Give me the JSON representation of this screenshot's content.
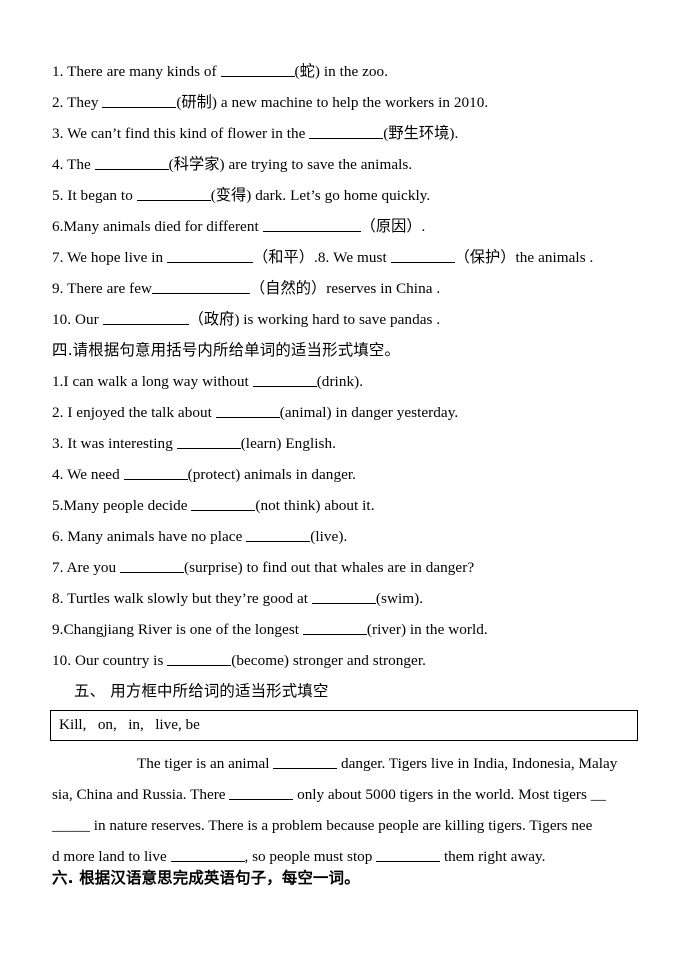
{
  "document": {
    "background_color": "#ffffff",
    "text_color": "#000000"
  },
  "section_three_questions": [
    {
      "id": "q1",
      "pre": "1. There are many kinds of ",
      "blank": "b-lg",
      "post": "(蛇) in the zoo."
    },
    {
      "id": "q2",
      "pre": "2. They ",
      "blank": "b-lg",
      "post": "(研制) a new machine to help the workers in 2010."
    },
    {
      "id": "q3",
      "pre": "3. We can’t find this kind of flower in the ",
      "blank": "b-lg",
      "post": "(野生环境)."
    },
    {
      "id": "q4",
      "pre": "4. The ",
      "blank": "b-lg",
      "post": "(科学家) are trying to save the animals."
    },
    {
      "id": "q5",
      "pre": "5. It began to ",
      "blank": "b-lg",
      "post": "(变得) dark. Let’s go home quickly."
    },
    {
      "id": "q6",
      "pre": " 6.Many animals died for different ",
      "blank": "b-xxl",
      "post": "（原因）."
    },
    {
      "id": "q7",
      "pre": "7. We hope live in ",
      "blank": "b-xl",
      "mid": "（和平）.8. We must ",
      "blank2": "b-md",
      "post": "（保护）the animals ."
    },
    {
      "id": "q9",
      "pre": "9. There are few",
      "blank": "b-xxl",
      "post": "（自然的）reserves in China ."
    },
    {
      "id": "q10",
      "pre": "10. Our ",
      "blank": "b-xl",
      "post": "（政府) is working hard to save pandas ."
    }
  ],
  "section_four": {
    "heading": "四.请根据句意用括号内所给单词的适当形式填空。",
    "questions": [
      {
        "id": "s4q1",
        "pre": "1.I can walk a long way without ",
        "blank": "b-md",
        "post": "(drink)."
      },
      {
        "id": "s4q2",
        "pre": "2. I enjoyed the talk about ",
        "blank": "b-md",
        "post": "(animal) in danger yesterday."
      },
      {
        "id": "s4q3",
        "pre": "3. It was interesting ",
        "blank": "b-md",
        "post": "(learn) English."
      },
      {
        "id": "s4q4",
        "pre": "4. We need ",
        "blank": "b-md",
        "post": "(protect) animals in danger."
      },
      {
        "id": "s4q5",
        "pre": " 5.Many people decide ",
        "blank": "b-md",
        "post": "(not think) about it."
      },
      {
        "id": "s4q6",
        "pre": "6. Many animals have no place ",
        "blank": "b-md",
        "post": "(live)."
      },
      {
        "id": "s4q7",
        "pre": "7. Are you ",
        "blank": "b-md",
        "post": "(surprise) to find out that whales are in danger?"
      },
      {
        "id": "s4q8",
        "pre": "8. Turtles walk slowly but they’re good at ",
        "blank": "b-md",
        "post": "(swim)."
      },
      {
        "id": "s4q9",
        "pre": "9.Changjiang River is one of the longest ",
        "blank": "b-md",
        "post": "(river) in the world."
      },
      {
        "id": "s4q10",
        "pre": "10. Our country is ",
        "blank": "b-md",
        "post": "(become) stronger and stronger."
      }
    ]
  },
  "section_five": {
    "heading": "五、  用方框中所给词的适当形式填空",
    "word_bank": "Kill,   on,   in,   live, be",
    "passage_lines": [
      {
        "id": "p1",
        "pre": "The tiger is an animal ",
        "blank": "b-md",
        "post": " danger. Tigers live in India, Indonesia, Malay"
      },
      {
        "id": "p2",
        "pre": "sia, China and Russia. There ",
        "blank": "b-md",
        "post": " only about 5000 tigers in the world. Most tigers __"
      },
      {
        "id": "p3",
        "pre": "_____ in nature reserves. There is a problem because people are killing tigers. Tigers nee",
        "blank": null,
        "post": ""
      },
      {
        "id": "p4",
        "pre": "d more land to live ",
        "blank": "b-lg",
        "mid": ", so people must stop ",
        "blank2": "b-md",
        "post": " them right away."
      }
    ]
  },
  "section_six": {
    "heading": "六. 根据汉语意思完成英语句子，每空一词。"
  }
}
